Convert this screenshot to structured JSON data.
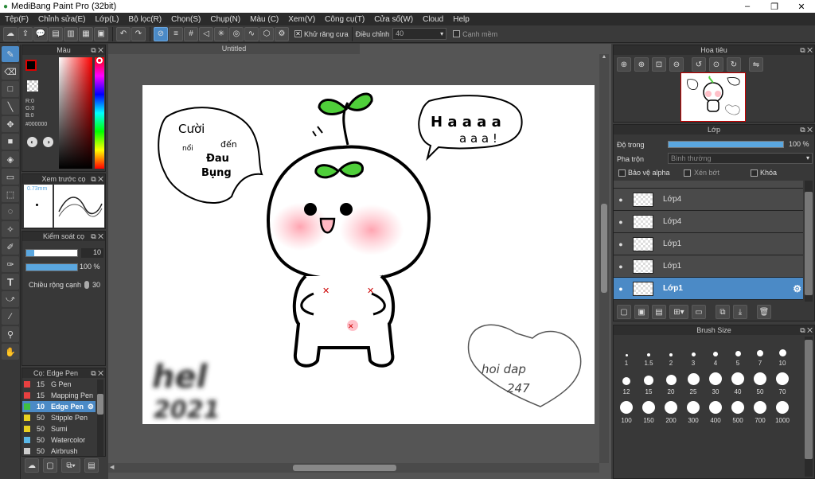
{
  "window": {
    "title": "MediBang Paint Pro (32bit)",
    "controls": [
      "–",
      "❐",
      "✕"
    ]
  },
  "menu": [
    "Tệp(F)",
    "Chỉnh sửa(E)",
    "Lớp(L)",
    "Bộ lọc(R)",
    "Chọn(S)",
    "Chụp(N)",
    "Màu (C)",
    "Xem(V)",
    "Công cụ(T)",
    "Cửa số(W)",
    "Cloud",
    "Help"
  ],
  "toolbar": {
    "antialias_label": "Khử răng cưa",
    "adjust_label": "Điều chỉnh",
    "adjust_value": "40",
    "edge_label": "Cạnh mềm"
  },
  "color_panel": {
    "title": "Màu",
    "r": "R:0",
    "g": "G:0",
    "b": "B:0",
    "hex": "#000000"
  },
  "brush_preview": {
    "title": "Xem trước cọ",
    "size": "0.73mm"
  },
  "brush_control": {
    "title": "Kiểm soát cọ",
    "size_value": "10",
    "opacity_value": "100 %",
    "width_label": "Chiều rộng cạnh",
    "width_value": "30"
  },
  "brush_list": {
    "title": "Cọ: Edge Pen",
    "items": [
      {
        "size": "15",
        "name": "G Pen",
        "color": "#e84040"
      },
      {
        "size": "15",
        "name": "Mapping Pen",
        "color": "#e84040"
      },
      {
        "size": "10",
        "name": "Edge Pen",
        "color": "#40c040"
      },
      {
        "size": "50",
        "name": "Stipple Pen",
        "color": "#e8d020"
      },
      {
        "size": "50",
        "name": "Sumi",
        "color": "#e8d020"
      },
      {
        "size": "50",
        "name": "Watercolor",
        "color": "#5ab8e8"
      },
      {
        "size": "50",
        "name": "Airbrush",
        "color": "#cccccc"
      }
    ]
  },
  "document": {
    "tab": "Untitled"
  },
  "artwork": {
    "bubble1": [
      "Cười",
      "nổi",
      "đến",
      "Đau",
      "Bụng"
    ],
    "bubble2": [
      "H a a a a",
      "a a a !"
    ],
    "sign": [
      "hel",
      "2021"
    ],
    "heart": [
      "hoi dap",
      "247"
    ]
  },
  "navigator": {
    "title": "Hoa tiêu"
  },
  "layer_panel": {
    "title": "Lớp",
    "opacity_label": "Độ trong",
    "opacity_value": "100 %",
    "blend_label": "Pha trộn",
    "blend_value": "Bình thường",
    "protect_alpha": "Bảo vệ alpha",
    "clip": "Xén bớt",
    "lock": "Khóa",
    "layers": [
      "Lớp4",
      "Lớp4",
      "Lớp1",
      "Lớp1",
      "Lớp1"
    ]
  },
  "brush_size": {
    "title": "Brush Size",
    "sizes": [
      "1",
      "1.5",
      "2",
      "3",
      "4",
      "5",
      "7",
      "10",
      "12",
      "15",
      "20",
      "25",
      "30",
      "40",
      "50",
      "70",
      "100",
      "150",
      "200",
      "300",
      "400",
      "500",
      "700",
      "1000"
    ]
  }
}
